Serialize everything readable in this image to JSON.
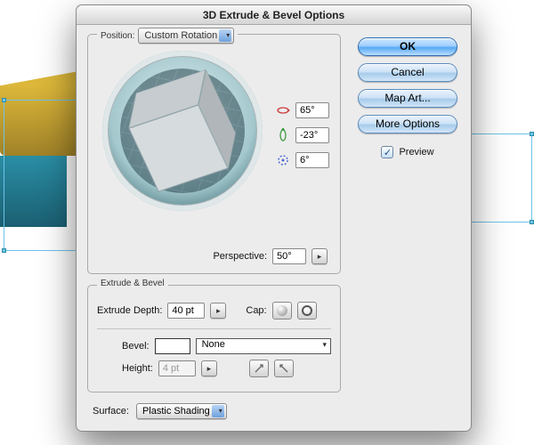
{
  "title": "3D Extrude & Bevel Options",
  "position": {
    "legend": "Position:",
    "rotation_preset": "Custom Rotation",
    "angle_x": "65°",
    "angle_y": "-23°",
    "angle_z": "6°",
    "perspective_label": "Perspective:",
    "perspective": "50°"
  },
  "extrude_bevel": {
    "legend": "Extrude & Bevel",
    "depth_label": "Extrude Depth:",
    "depth": "40 pt",
    "cap_label": "Cap:",
    "bevel_label": "Bevel:",
    "bevel": "None",
    "height_label": "Height:",
    "height": "4 pt"
  },
  "surface": {
    "label": "Surface:",
    "value": "Plastic Shading"
  },
  "buttons": {
    "ok": "OK",
    "cancel": "Cancel",
    "map_art": "Map Art...",
    "more_options": "More Options",
    "preview": "Preview",
    "preview_checked": true
  },
  "colors": {
    "accent": "#6fa1dc",
    "cube_top": "#6ba8b4",
    "cube_side": "#c6cccf"
  }
}
